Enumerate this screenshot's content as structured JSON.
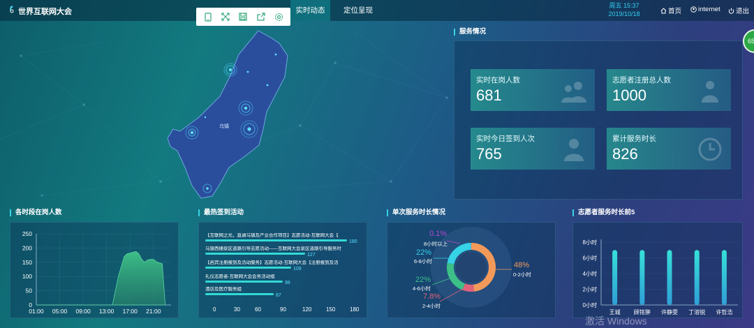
{
  "app": {
    "title": "世界互联网大会"
  },
  "toolbar": {
    "icons": [
      "tablet-icon",
      "fullscreen-icon",
      "save-icon",
      "share-icon",
      "settings-icon"
    ]
  },
  "tabs": [
    {
      "label": "实时动态",
      "active": true
    },
    {
      "label": "定位呈现",
      "active": false
    }
  ],
  "header": {
    "weekday_time": "周五 15:37",
    "date": "2019/10/18",
    "nav": {
      "home": "首页",
      "internet": "internet",
      "logout": "退出"
    },
    "badge": "65"
  },
  "map": {
    "town_label": "乌镇"
  },
  "service": {
    "title": "服务情况",
    "cards": [
      {
        "label": "实时在岗人数",
        "value": "681"
      },
      {
        "label": "志愿者注册总人数",
        "value": "1000"
      },
      {
        "label": "实时今日签到人次",
        "value": "765"
      },
      {
        "label": "累计服务时长",
        "value": "826"
      }
    ]
  },
  "sections": {
    "on_duty": "各时段在岗人数",
    "hot_activities": "最热签到活动",
    "single_duration": "单次服务时长情况",
    "top5": "志愿者服务时长前5"
  },
  "hot_activities": {
    "items": [
      {
        "name": "【互联网之光，直通乌镇及产业合作项目】志愿活动-互联网大会【",
        "value": 180
      },
      {
        "name": "乌镇西栅景区道路引导志愿活动——互联网大会景区道路引导服务时",
        "value": 127
      },
      {
        "name": "【邑宾注册报到及活动服务】志愿活动-互联网大会【注册报到及活",
        "value": 109
      },
      {
        "name": "礼仪志愿者-互联网大会会务活动组",
        "value": 98
      },
      {
        "name": "酒店及医疗服务组",
        "value": 87
      }
    ],
    "axis_ticks": [
      "0",
      "30",
      "60",
      "90",
      "120",
      "150",
      "180"
    ]
  },
  "colors": {
    "accent": "#36d2e6",
    "bar": "#32d9d5",
    "area": "#3dbf88"
  },
  "chart_data": [
    {
      "type": "area",
      "title": "各时段在岗人数",
      "x_ticks": [
        "01:00",
        "05:00",
        "09:00",
        "13:00",
        "17:00",
        "21:00"
      ],
      "y_ticks": [
        "0",
        "50",
        "100",
        "150",
        "200",
        "250"
      ],
      "ylim": [
        0,
        250
      ],
      "xlim": [
        1,
        24
      ],
      "x": [
        1,
        13,
        14,
        15,
        16,
        16.5,
        17,
        17.5,
        18,
        18.5,
        19,
        19.5,
        20,
        20.5,
        21,
        21.5,
        22,
        22.5,
        23
      ],
      "values": [
        0,
        0,
        0,
        100,
        170,
        180,
        182,
        185,
        188,
        180,
        160,
        150,
        158,
        160,
        160,
        152,
        148,
        145,
        0
      ],
      "grid": true
    },
    {
      "type": "bar",
      "title": "最热签到活动",
      "orientation": "horizontal",
      "values": [
        180,
        127,
        109,
        98,
        87
      ],
      "xlim": [
        0,
        180
      ]
    },
    {
      "type": "pie",
      "title": "单次服务时长情况",
      "labels": [
        "8小时以上",
        "6-8小时",
        "4-6小时",
        "2-4小时",
        "0-2小时"
      ],
      "percents": [
        0.1,
        22,
        22,
        7.8,
        48
      ],
      "values": [
        0.1,
        22,
        22,
        7.8,
        48
      ],
      "colors": [
        "#b44bd0",
        "#36d2e6",
        "#3dbf88",
        "#e0627a",
        "#f39a5b"
      ]
    },
    {
      "type": "bar",
      "title": "志愿者服务时长前5",
      "categories": [
        "王城",
        "顾铭翀",
        "许静雯",
        "丁溶锐",
        "许哲浩"
      ],
      "values": [
        7,
        7,
        7,
        7,
        7
      ],
      "y_ticks": [
        "0小时",
        "2小时",
        "4小时",
        "6小时",
        "8小时"
      ],
      "ylim": [
        0,
        8
      ]
    }
  ],
  "watermark": "激活 Windows"
}
